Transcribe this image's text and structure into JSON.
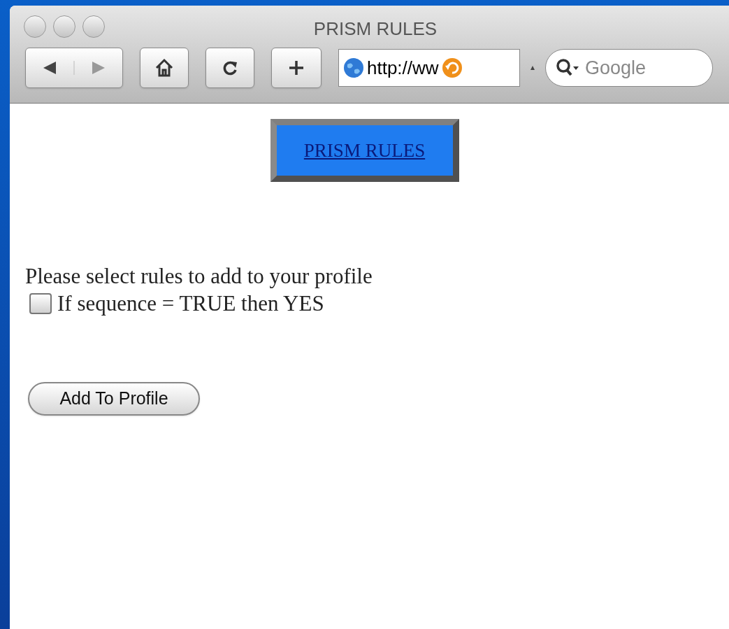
{
  "window": {
    "title": "PRISM RULES"
  },
  "toolbar": {
    "address": "http://ww",
    "search_placeholder": "Google"
  },
  "banner": {
    "link": "PRISM RULES"
  },
  "prompt": "Please select rules to add to your profile",
  "rules": [
    {
      "label": "If sequence = TRUE then YES",
      "checked": false
    }
  ],
  "submit_button": "Add To Profile"
}
